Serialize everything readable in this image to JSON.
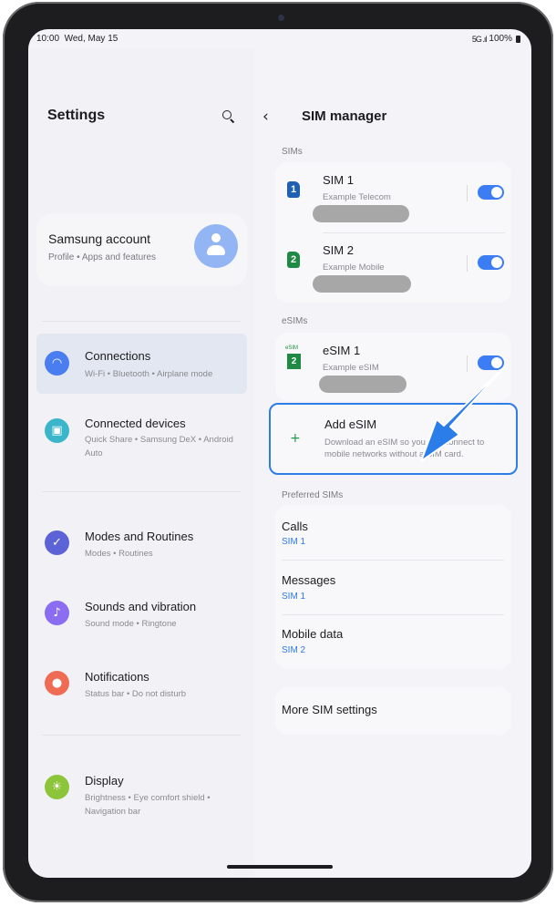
{
  "status_bar": {
    "time": "10:00",
    "date": "Wed, May 15",
    "signal": "5G .ıl",
    "battery": "100%"
  },
  "left_panel": {
    "title": "Settings",
    "account": {
      "title": "Samsung account",
      "subtitle": "Profile  •  Apps and features"
    },
    "items": [
      {
        "label": "Connections",
        "sub": "Wi-Fi  •  Bluetooth  •  Airplane mode",
        "icon": "wifi-icon",
        "color": "#4a7df0"
      },
      {
        "label": "Connected devices",
        "sub": "Quick Share  •  Samsung DeX  •  Android Auto",
        "icon": "connected-devices-icon",
        "color": "#3bb5c9"
      },
      {
        "label": "Modes and Routines",
        "sub": "Modes  •  Routines",
        "icon": "modes-icon",
        "color": "#5b63d6"
      },
      {
        "label": "Sounds and vibration",
        "sub": "Sound mode  •  Ringtone",
        "icon": "volume-icon",
        "color": "#8a6df0"
      },
      {
        "label": "Notifications",
        "sub": "Status bar  •  Do not disturb",
        "icon": "notification-icon",
        "color": "#ef6b54"
      },
      {
        "label": "Display",
        "sub": "Brightness  •  Eye comfort shield  •  Navigation bar",
        "icon": "brightness-icon",
        "color": "#8cc43a"
      }
    ]
  },
  "right_panel": {
    "title": "SIM manager",
    "sims_label": "SIMs",
    "sims": [
      {
        "name": "SIM 1",
        "carrier": "Example Telecom",
        "slot": "1",
        "color": "#1f5fb5",
        "enabled": true
      },
      {
        "name": "SIM 2",
        "carrier": "Example Mobile",
        "slot": "2",
        "color": "#1e8a44",
        "enabled": true
      }
    ],
    "esims_label": "eSIMs",
    "esim": {
      "name": "eSIM 1",
      "carrier": "Example eSIM",
      "badge": "eSIM",
      "slot": "2",
      "enabled": true
    },
    "add_esim": {
      "title": "Add eSIM",
      "desc": "Download an eSIM so you can connect to mobile networks without a SIM card."
    },
    "preferred_label": "Preferred SIMs",
    "preferred": [
      {
        "label": "Calls",
        "value": "SIM 1"
      },
      {
        "label": "Messages",
        "value": "SIM 1"
      },
      {
        "label": "Mobile data",
        "value": "SIM 2"
      }
    ],
    "more": "More SIM settings"
  },
  "colors": {
    "accent": "#3c7cf4",
    "highlight_border": "#2d7de8",
    "arrow": "#2b7de9"
  }
}
